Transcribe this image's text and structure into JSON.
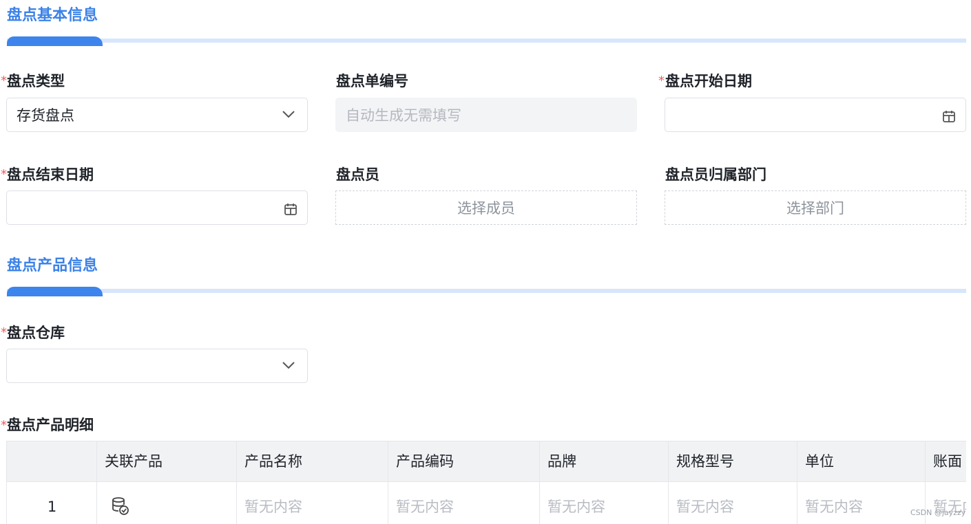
{
  "sections": {
    "basic": "盘点基本信息",
    "product": "盘点产品信息"
  },
  "fields": {
    "type": {
      "label": "盘点类型",
      "value": "存货盘点"
    },
    "order_no": {
      "label": "盘点单编号",
      "placeholder": "自动生成无需填写"
    },
    "start_date": {
      "label": "盘点开始日期",
      "value": ""
    },
    "end_date": {
      "label": "盘点结束日期",
      "value": ""
    },
    "staff": {
      "label": "盘点员",
      "button": "选择成员"
    },
    "department": {
      "label": "盘点员归属部门",
      "button": "选择部门"
    },
    "warehouse": {
      "label": "盘点仓库",
      "value": ""
    },
    "detail": {
      "label": "盘点产品明细"
    }
  },
  "required_mark": "*",
  "table": {
    "columns": [
      "关联产品",
      "产品名称",
      "产品编码",
      "品牌",
      "规格型号",
      "单位",
      "账面"
    ],
    "rows": [
      {
        "index": "1",
        "empty": "暂无内容"
      }
    ]
  },
  "watermark": "CSDN @jayzzy",
  "colors": {
    "accent": "#3d84ec",
    "required": "#f25c5c",
    "section_line": "#d7e6fb"
  }
}
